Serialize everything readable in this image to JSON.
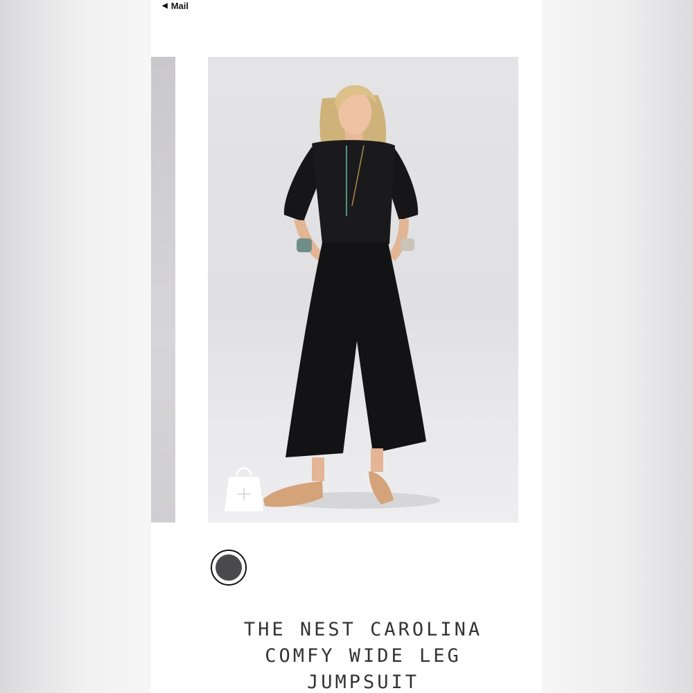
{
  "status_bar": {
    "back_label": "Mail",
    "back_icon": "triangle-left-icon"
  },
  "product": {
    "title_lines": [
      "THE NEST CAROLINA",
      "COMFY WIDE LEG",
      "JUMPSUIT"
    ],
    "selected_color": "#4a4a4c",
    "add_to_bag_icon": "shopping-bag-plus-icon"
  }
}
